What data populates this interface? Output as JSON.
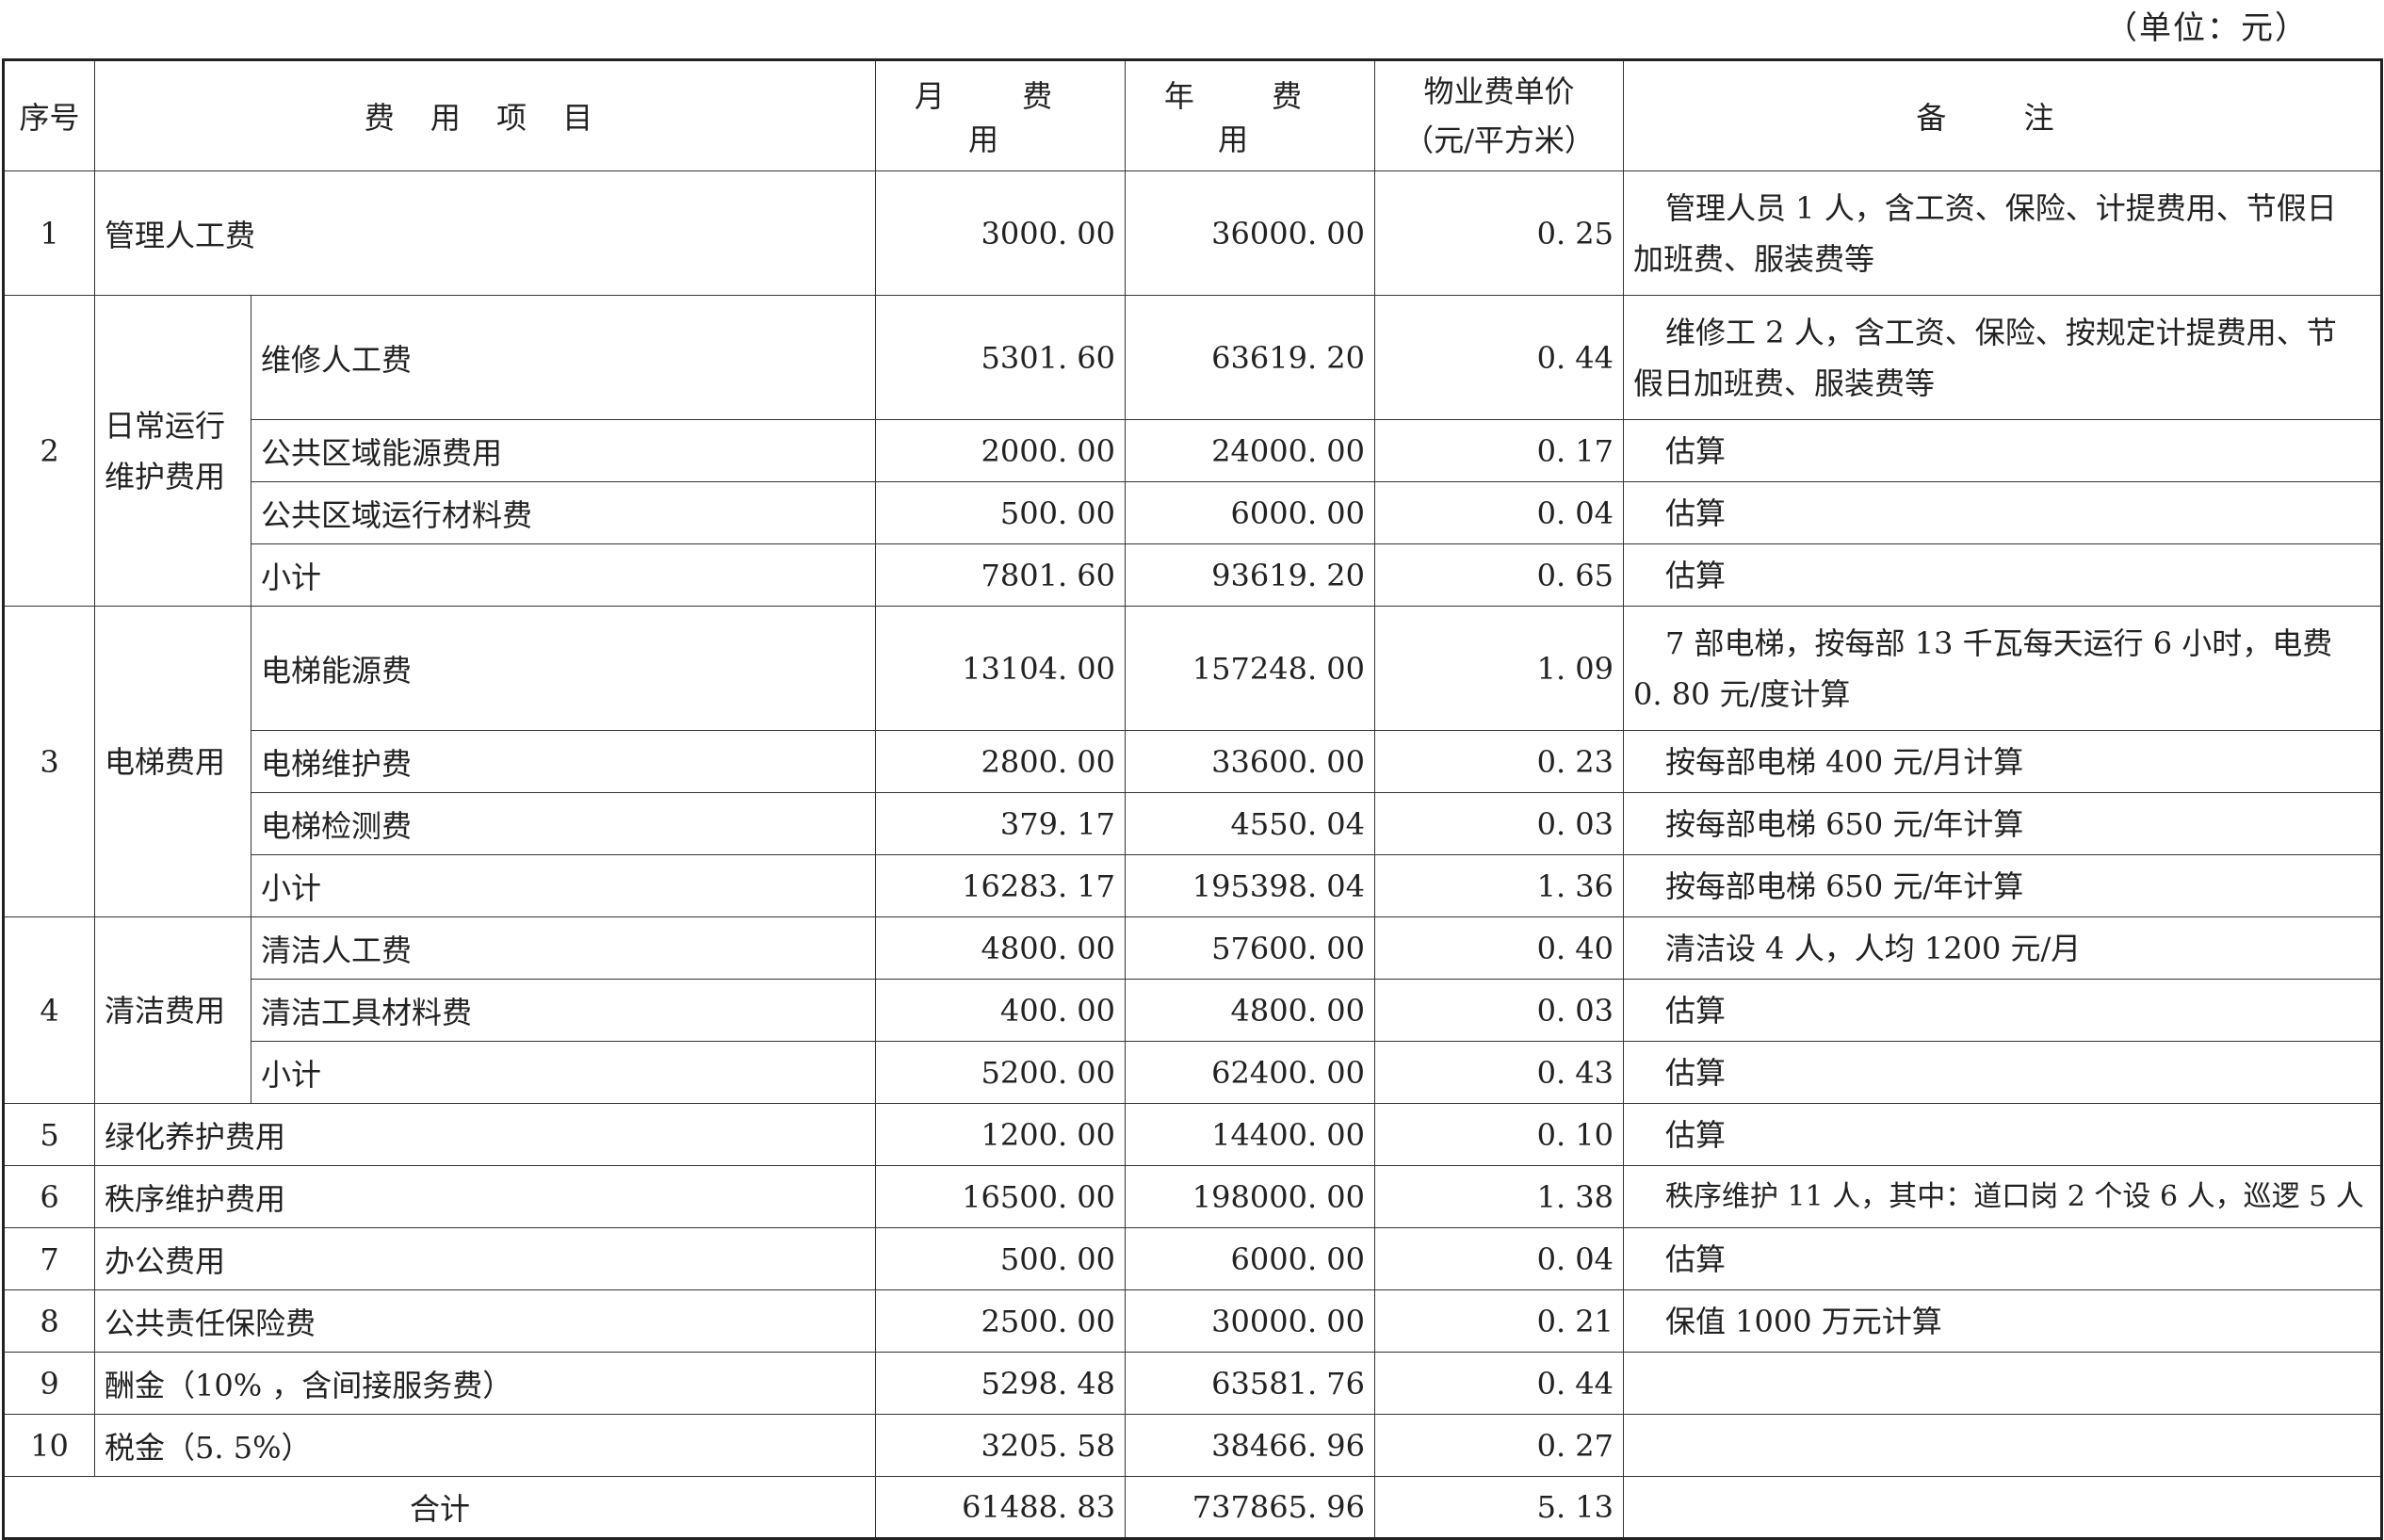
{
  "unit": "（单位：元）",
  "headers": {
    "seq": "序号",
    "item": "费 用 项 目",
    "monthly": "月 费 用",
    "annual": "年 费 用",
    "unit_price_l1": "物业费单价",
    "unit_price_l2": "（元/平方米）",
    "note": "备 注"
  },
  "rows": {
    "r1": {
      "seq": "1",
      "item": "管理人工费",
      "monthly": "3000. 00",
      "annual": "36000. 00",
      "price": "0. 25",
      "note1": "管理人员 1 人，含工资、保险、计提费用、节假日",
      "note2": "加班费、服装费等"
    },
    "g2": {
      "seq": "2",
      "cat1": "日常运行",
      "cat2": "维护费用"
    },
    "r2a": {
      "item": "维修人工费",
      "monthly": "5301. 60",
      "annual": "63619. 20",
      "price": "0. 44",
      "note1": "维修工 2 人，含工资、保险、按规定计提费用、节",
      "note2": "假日加班费、服装费等"
    },
    "r2b": {
      "item": "公共区域能源费用",
      "monthly": "2000. 00",
      "annual": "24000. 00",
      "price": "0. 17",
      "note": "估算"
    },
    "r2c": {
      "item": "公共区域运行材料费",
      "monthly": "500. 00",
      "annual": "6000. 00",
      "price": "0. 04",
      "note": "估算"
    },
    "r2d": {
      "item": "小计",
      "monthly": "7801. 60",
      "annual": "93619. 20",
      "price": "0. 65",
      "note": "估算"
    },
    "g3": {
      "seq": "3",
      "cat": "电梯费用"
    },
    "r3a": {
      "item": "电梯能源费",
      "monthly": "13104. 00",
      "annual": "157248. 00",
      "price": "1. 09",
      "note1": "7 部电梯，按每部 13 千瓦每天运行 6 小时，电费",
      "note2": "0. 80 元/度计算"
    },
    "r3b": {
      "item": "电梯维护费",
      "monthly": "2800. 00",
      "annual": "33600. 00",
      "price": "0. 23",
      "note": "按每部电梯 400 元/月计算"
    },
    "r3c": {
      "item": "电梯检测费",
      "monthly": "379. 17",
      "annual": "4550. 04",
      "price": "0. 03",
      "note": "按每部电梯 650 元/年计算"
    },
    "r3d": {
      "item": "小计",
      "monthly": "16283. 17",
      "annual": "195398. 04",
      "price": "1. 36",
      "note": "按每部电梯 650 元/年计算"
    },
    "g4": {
      "seq": "4",
      "cat": "清洁费用"
    },
    "r4a": {
      "item": "清洁人工费",
      "monthly": "4800. 00",
      "annual": "57600. 00",
      "price": "0. 40",
      "note": "清洁设 4 人，人均 1200 元/月"
    },
    "r4b": {
      "item": "清洁工具材料费",
      "monthly": "400. 00",
      "annual": "4800. 00",
      "price": "0. 03",
      "note": "估算"
    },
    "r4c": {
      "item": "小计",
      "monthly": "5200. 00",
      "annual": "62400. 00",
      "price": "0. 43",
      "note": "估算"
    },
    "r5": {
      "seq": "5",
      "item": "绿化养护费用",
      "monthly": "1200. 00",
      "annual": "14400. 00",
      "price": "0. 10",
      "note": "估算"
    },
    "r6": {
      "seq": "6",
      "item": "秩序维护费用",
      "monthly": "16500. 00",
      "annual": "198000. 00",
      "price": "1. 38",
      "note": "秩序维护 11 人，其中：道口岗 2 个设 6 人，巡逻 5 人"
    },
    "r7": {
      "seq": "7",
      "item": "办公费用",
      "monthly": "500. 00",
      "annual": "6000. 00",
      "price": "0. 04",
      "note": "估算"
    },
    "r8": {
      "seq": "8",
      "item": "公共责任保险费",
      "monthly": "2500. 00",
      "annual": "30000. 00",
      "price": "0. 21",
      "note": "保值 1000 万元计算"
    },
    "r9": {
      "seq": "9",
      "item": "酬金（10% ，含间接服务费）",
      "monthly": "5298. 48",
      "annual": "63581. 76",
      "price": "0. 44",
      "note": ""
    },
    "r10": {
      "seq": "10",
      "item": "税金（5. 5%）",
      "monthly": "3205. 58",
      "annual": "38466. 96",
      "price": "0. 27",
      "note": ""
    },
    "total": {
      "label": "合计",
      "monthly": "61488. 83",
      "annual": "737865. 96",
      "price": "5. 13",
      "note": ""
    }
  }
}
